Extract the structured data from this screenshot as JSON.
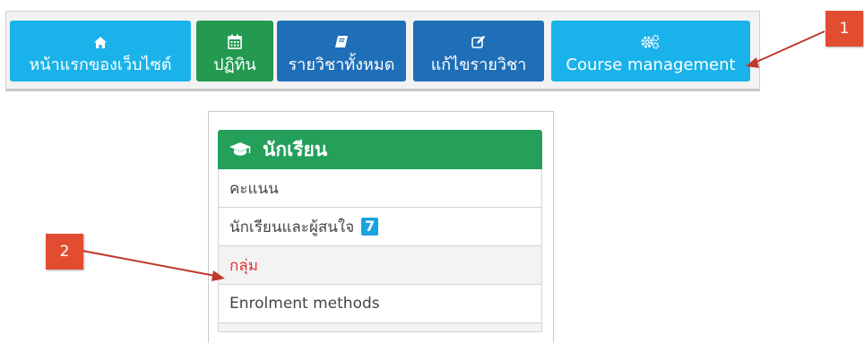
{
  "nav": {
    "items": [
      {
        "label": "หน้าแรกของเว็บไซต์",
        "icon": "home-icon",
        "color": "#1ab2ea"
      },
      {
        "label": "ปฏิทิน",
        "icon": "calendar-icon",
        "color": "#239a50"
      },
      {
        "label": "รายวิชาทั้งหมด",
        "icon": "book-icon",
        "color": "#1f6fb8"
      },
      {
        "label": "แก้ไขรายวิชา",
        "icon": "edit-icon",
        "color": "#1f6fb8"
      },
      {
        "label": "Course management",
        "icon": "gears-icon",
        "color": "#1ab2ea"
      }
    ]
  },
  "panel": {
    "title": "นักเรียน",
    "icon": "graduation-cap-icon",
    "header_color": "#25a05a",
    "items": [
      {
        "label": "คะแนน"
      },
      {
        "label": "นักเรียนและผู้สนใจ",
        "badge": "7"
      },
      {
        "label": "กลุ่ม",
        "active_color": "#e0302f"
      },
      {
        "label": "Enrolment methods"
      }
    ]
  },
  "callouts": [
    {
      "number": "1",
      "color": "#e24c30"
    },
    {
      "number": "2",
      "color": "#e24c30"
    }
  ]
}
